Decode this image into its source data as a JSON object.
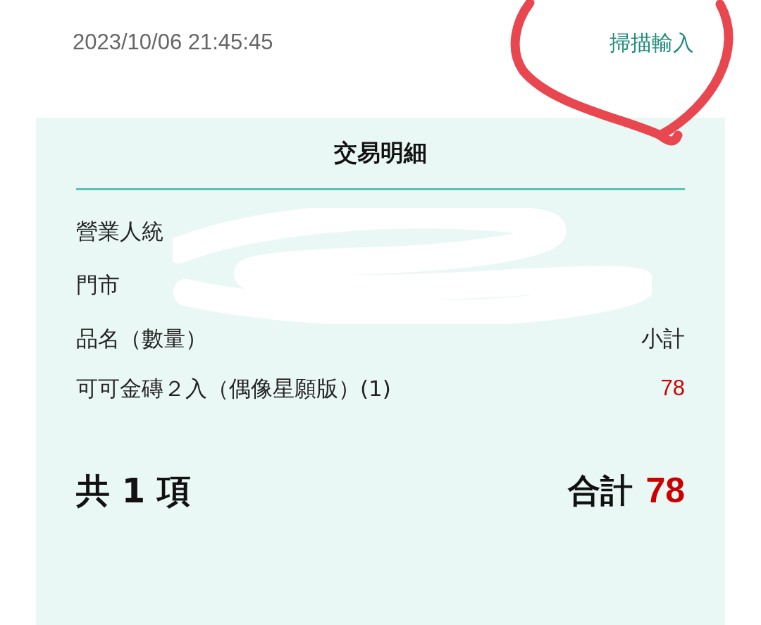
{
  "header": {
    "datetime": "2023/10/06 21:45:45",
    "scan_link": "掃描輸入"
  },
  "card": {
    "title": "交易明細",
    "info_lines": [
      "營業人統",
      "門市"
    ],
    "columns": [
      "品名（數量）",
      "小計"
    ],
    "items": [
      {
        "name": "可可金磚２入（偶像星願版）(1)",
        "subtotal": "78"
      }
    ],
    "count_label": "共 1 項",
    "total_label": "合計",
    "total": "78"
  }
}
